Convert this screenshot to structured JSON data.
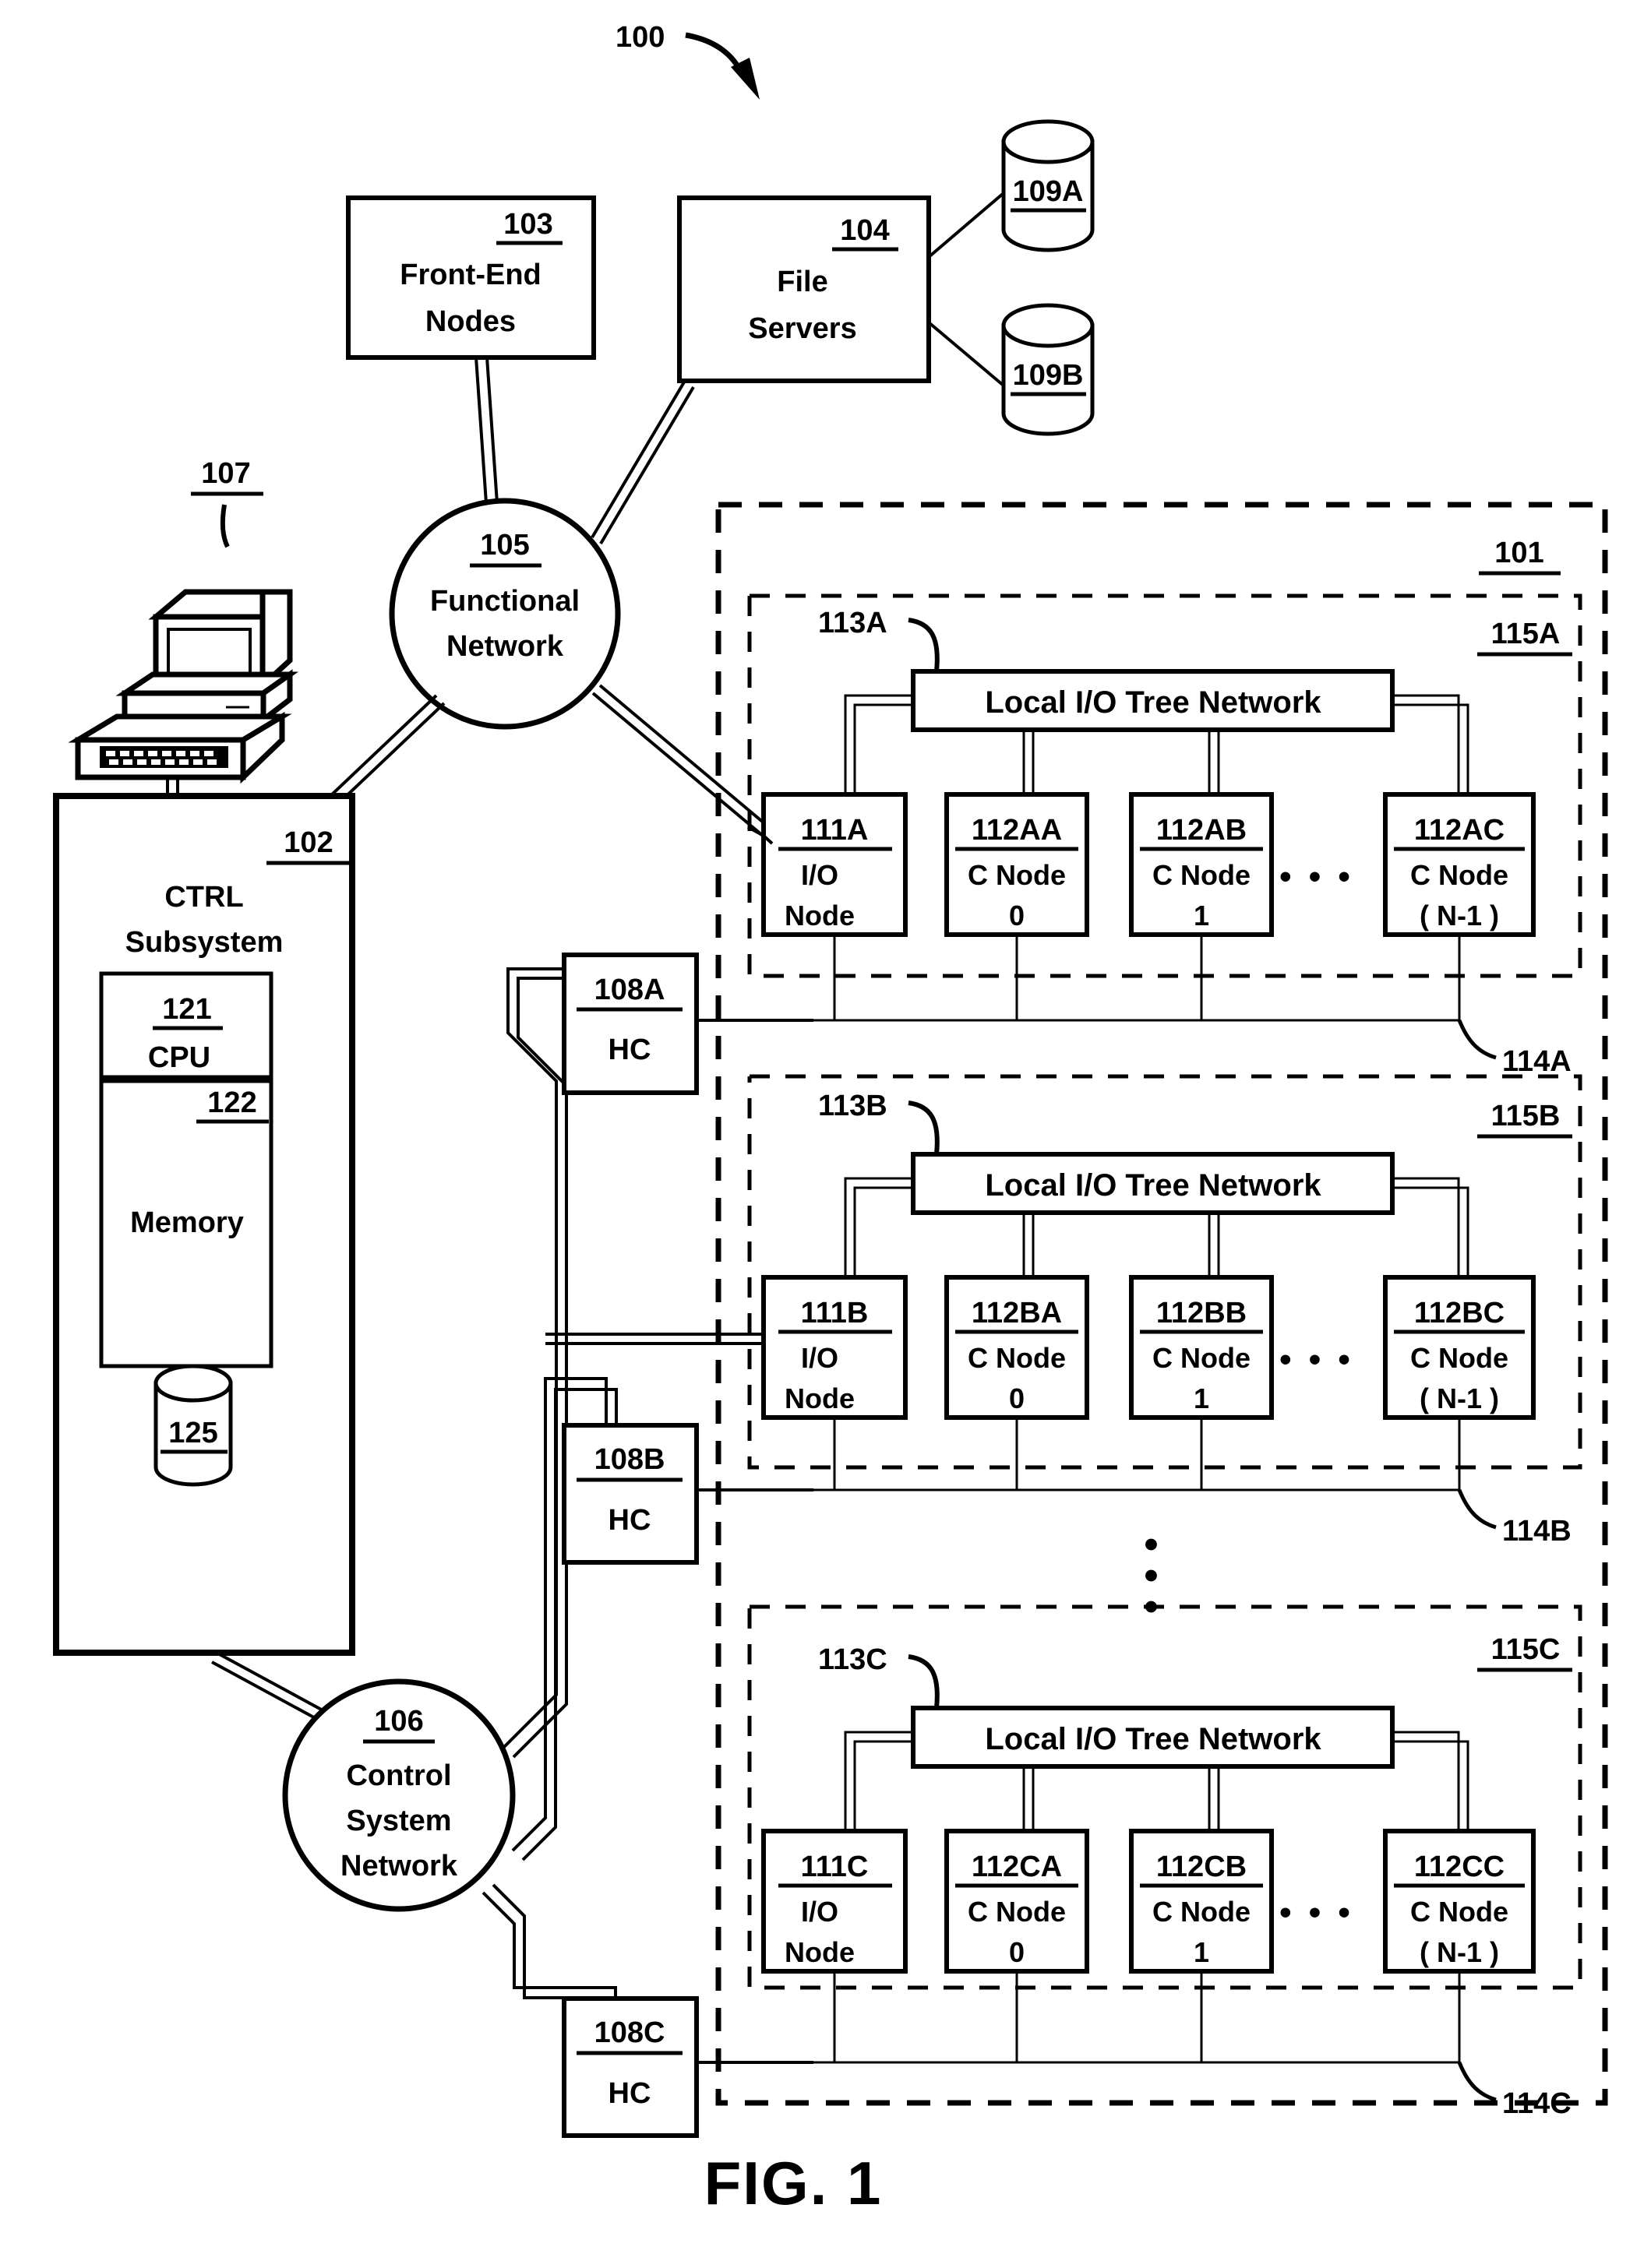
{
  "figure": {
    "caption": "FIG. 1",
    "system_ref": "100"
  },
  "top_blocks": [
    {
      "ref": "103",
      "line1": "Front-End",
      "line2": "Nodes"
    },
    {
      "ref": "104",
      "line1": "File",
      "line2": "Servers"
    }
  ],
  "disks": [
    {
      "ref": "109A"
    },
    {
      "ref": "109B"
    }
  ],
  "workstation": {
    "ref": "107",
    "icon": "computer-workstation-icon"
  },
  "networks": [
    {
      "ref": "105",
      "line1": "Functional",
      "line2": "Network",
      "line3": ""
    },
    {
      "ref": "106",
      "line1": "Control",
      "line2": "System",
      "line3": "Network"
    }
  ],
  "ctrl_subsystem": {
    "ref": "102",
    "title_line1": "CTRL",
    "title_line2": "Subsystem",
    "cpu": {
      "ref": "121",
      "label": "CPU"
    },
    "memory": {
      "ref": "122",
      "label": "Memory"
    },
    "disk": {
      "ref": "125"
    }
  },
  "hc_boxes": [
    {
      "ref": "108A",
      "label": "HC"
    },
    {
      "ref": "108B",
      "label": "HC"
    },
    {
      "ref": "108C",
      "label": "HC"
    }
  ],
  "compute_core": {
    "ref": "101",
    "vertical_ellipsis": "⋮",
    "racks": [
      {
        "rack_ref": "115A",
        "tree_ref": "113A",
        "tree_label": "Local I/O Tree Network",
        "bus_ref": "114A",
        "nodes": [
          {
            "ref": "111A",
            "line1": "I/O",
            "line2": "Node"
          },
          {
            "ref": "112AA",
            "line1": "C Node",
            "line2": "0"
          },
          {
            "ref": "112AB",
            "line1": "C Node",
            "line2": "1"
          },
          {
            "ref": "112AC",
            "line1": "C Node",
            "line2": "( N-1 )"
          }
        ],
        "ellipsis": "• • •"
      },
      {
        "rack_ref": "115B",
        "tree_ref": "113B",
        "tree_label": "Local I/O Tree Network",
        "bus_ref": "114B",
        "nodes": [
          {
            "ref": "111B",
            "line1": "I/O",
            "line2": "Node"
          },
          {
            "ref": "112BA",
            "line1": "C Node",
            "line2": "0"
          },
          {
            "ref": "112BB",
            "line1": "C Node",
            "line2": "1"
          },
          {
            "ref": "112BC",
            "line1": "C Node",
            "line2": "( N-1 )"
          }
        ],
        "ellipsis": "• • •"
      },
      {
        "rack_ref": "115C",
        "tree_ref": "113C",
        "tree_label": "Local I/O Tree Network",
        "bus_ref": "114C",
        "nodes": [
          {
            "ref": "111C",
            "line1": "I/O",
            "line2": "Node"
          },
          {
            "ref": "112CA",
            "line1": "C Node",
            "line2": "0"
          },
          {
            "ref": "112CB",
            "line1": "C Node",
            "line2": "1"
          },
          {
            "ref": "112CC",
            "line1": "C Node",
            "line2": "( N-1 )"
          }
        ],
        "ellipsis": "• • •"
      }
    ]
  },
  "colors": {
    "ink": "#000000",
    "paper": "#ffffff"
  }
}
